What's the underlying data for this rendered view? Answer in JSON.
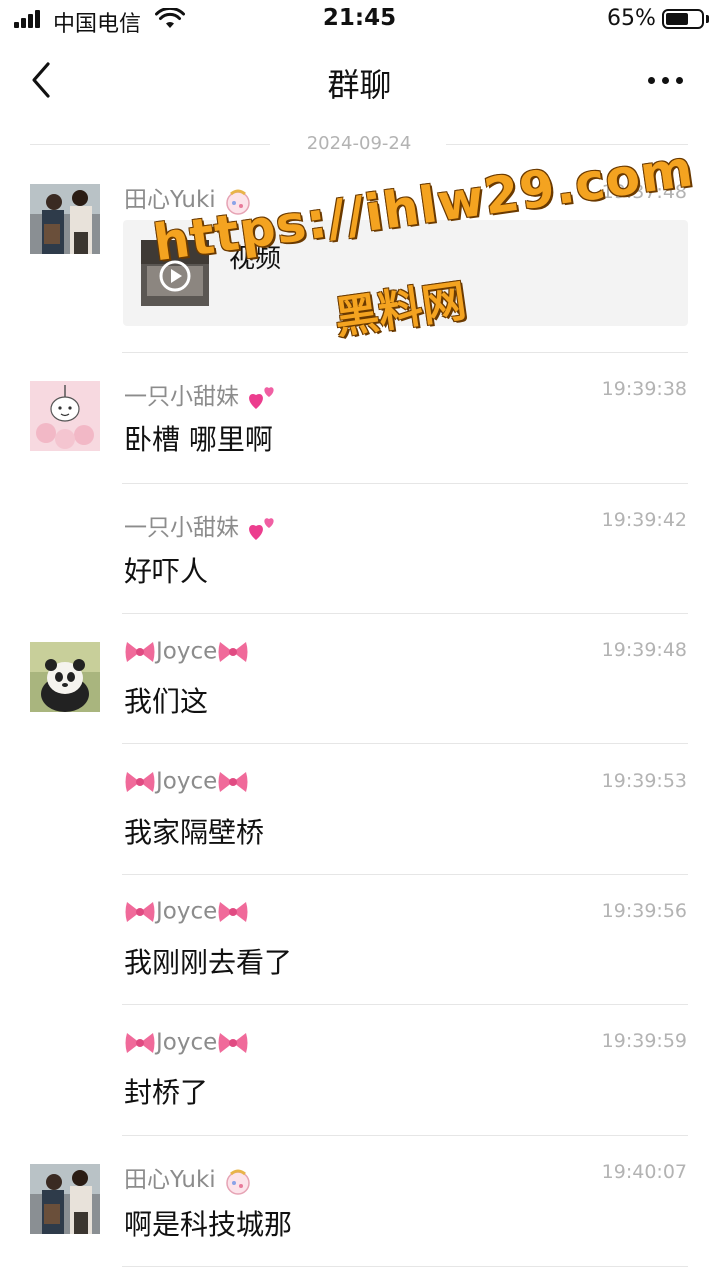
{
  "status_bar": {
    "carrier": "中国电信",
    "time": "21:45",
    "battery_percent": "65%",
    "battery_level": 0.65,
    "signal_bars": 4,
    "wifi_icon": "wifi-icon"
  },
  "nav": {
    "title": "群聊",
    "back_icon": "chevron-left-icon",
    "more_icon": "more-dots-icon"
  },
  "date_divider": "2024-09-24",
  "messages": [
    {
      "name": "田心Yuki",
      "name_emoji": "balloon-gift-icon",
      "time": "19:37:48",
      "type": "video",
      "video_label": "视频",
      "avatar": "couple-photo-avatar"
    },
    {
      "name": "一只小甜妹",
      "name_emoji": "two-hearts-icon",
      "time": "19:39:38",
      "text": "卧槽 哪里啊",
      "avatar": "cartoon-pink-avatar"
    },
    {
      "name": "一只小甜妹",
      "name_emoji": "two-hearts-icon",
      "time": "19:39:42",
      "text": "好吓人"
    },
    {
      "name": "Joyce",
      "name_emoji": "ribbon-icon",
      "time": "19:39:48",
      "text": "我们这",
      "avatar": "panda-avatar"
    },
    {
      "name": "Joyce",
      "name_emoji": "ribbon-icon",
      "time": "19:39:53",
      "text": "我家隔壁桥"
    },
    {
      "name": "Joyce",
      "name_emoji": "ribbon-icon",
      "time": "19:39:56",
      "text": "我刚刚去看了"
    },
    {
      "name": "Joyce",
      "name_emoji": "ribbon-icon",
      "time": "19:39:59",
      "text": "封桥了"
    },
    {
      "name": "田心Yuki",
      "name_emoji": "balloon-gift-icon",
      "time": "19:40:07",
      "text": "啊是科技城那",
      "avatar": "couple-photo-avatar"
    }
  ],
  "watermark": {
    "line1": "https://ihlw29.com",
    "line2": "黑料网"
  },
  "colors": {
    "name_gray": "#8c8c8c",
    "time_gray": "#b3b3b3",
    "separator": "#e6e6e6",
    "watermark_orange": "#f4a320"
  }
}
